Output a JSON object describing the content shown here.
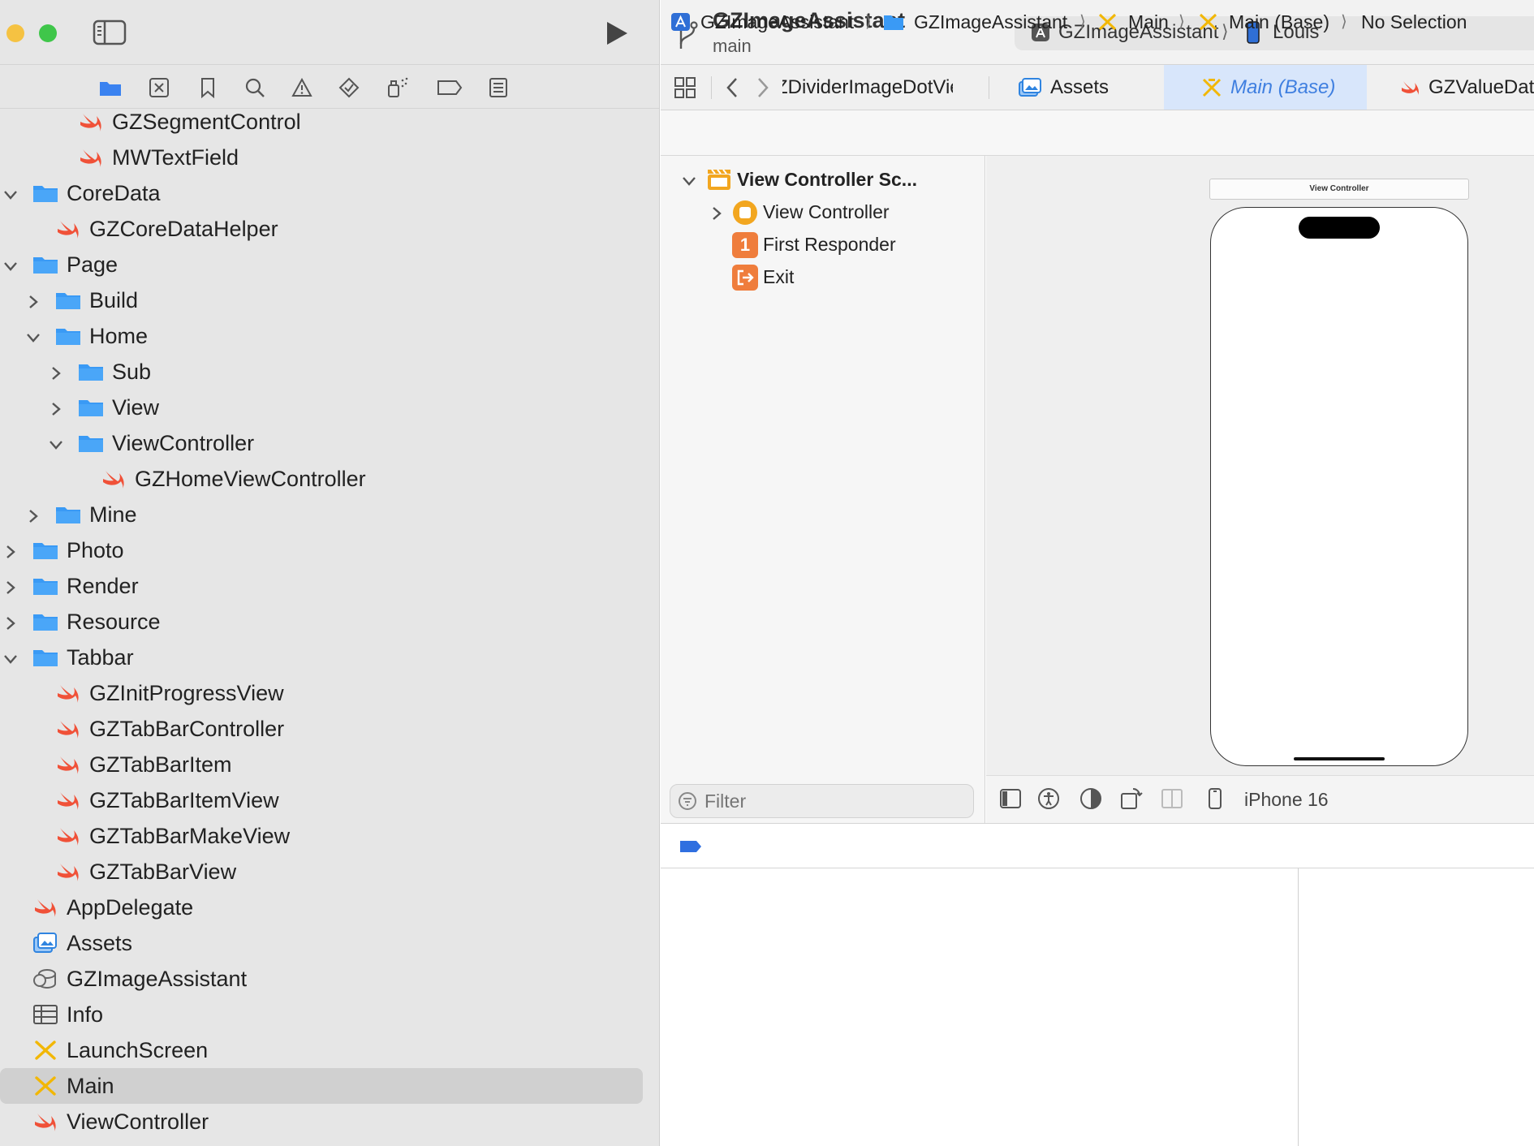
{
  "navigator": {
    "tree": [
      {
        "label": "GZSegmentControl",
        "icon": "swift-file-icon",
        "depth": 3
      },
      {
        "label": "MWTextField",
        "icon": "swift-file-icon",
        "depth": 3
      },
      {
        "label": "CoreData",
        "icon": "folder-icon",
        "depth": 1,
        "disclosure": "expanded"
      },
      {
        "label": "GZCoreDataHelper",
        "icon": "swift-file-icon",
        "depth": 2
      },
      {
        "label": "Page",
        "icon": "folder-icon",
        "depth": 1,
        "disclosure": "expanded"
      },
      {
        "label": "Build",
        "icon": "folder-icon",
        "depth": 2,
        "disclosure": "collapsed"
      },
      {
        "label": "Home",
        "icon": "folder-icon",
        "depth": 2,
        "disclosure": "expanded"
      },
      {
        "label": "Sub",
        "icon": "folder-icon",
        "depth": 3,
        "disclosure": "collapsed"
      },
      {
        "label": "View",
        "icon": "folder-icon",
        "depth": 3,
        "disclosure": "collapsed"
      },
      {
        "label": "ViewController",
        "icon": "folder-icon",
        "depth": 3,
        "disclosure": "expanded"
      },
      {
        "label": "GZHomeViewController",
        "icon": "swift-file-icon",
        "depth": 4
      },
      {
        "label": "Mine",
        "icon": "folder-icon",
        "depth": 2,
        "disclosure": "collapsed"
      },
      {
        "label": "Photo",
        "icon": "folder-icon",
        "depth": 1,
        "disclosure": "collapsed"
      },
      {
        "label": "Render",
        "icon": "folder-icon",
        "depth": 1,
        "disclosure": "collapsed"
      },
      {
        "label": "Resource",
        "icon": "folder-icon",
        "depth": 1,
        "disclosure": "collapsed"
      },
      {
        "label": "Tabbar",
        "icon": "folder-icon",
        "depth": 1,
        "disclosure": "expanded"
      },
      {
        "label": "GZInitProgressView",
        "icon": "swift-file-icon",
        "depth": 2
      },
      {
        "label": "GZTabBarController",
        "icon": "swift-file-icon",
        "depth": 2
      },
      {
        "label": "GZTabBarItem",
        "icon": "swift-file-icon",
        "depth": 2
      },
      {
        "label": "GZTabBarItemView",
        "icon": "swift-file-icon",
        "depth": 2
      },
      {
        "label": "GZTabBarMakeView",
        "icon": "swift-file-icon",
        "depth": 2
      },
      {
        "label": "GZTabBarView",
        "icon": "swift-file-icon",
        "depth": 2
      },
      {
        "label": "AppDelegate",
        "icon": "swift-file-icon",
        "depth": 1
      },
      {
        "label": "Assets",
        "icon": "asset-catalog-icon",
        "depth": 1
      },
      {
        "label": "GZImageAssistant",
        "icon": "coredata-model-icon",
        "depth": 1
      },
      {
        "label": "Info",
        "icon": "plist-icon",
        "depth": 1
      },
      {
        "label": "LaunchScreen",
        "icon": "storyboard-icon",
        "depth": 1
      },
      {
        "label": "Main",
        "icon": "storyboard-icon",
        "depth": 1,
        "selected": true
      },
      {
        "label": "ViewController",
        "icon": "swift-file-icon",
        "depth": 1
      }
    ]
  },
  "toolbar": {
    "project_title": "GZImageAssistant",
    "branch": "main",
    "scheme": "GZImageAssistant",
    "scheme_separator": "⟩",
    "device": "Louis"
  },
  "tabs": [
    {
      "label": "ZDividerImageDotView",
      "icon": "none"
    },
    {
      "label": "Assets",
      "icon": "asset-catalog-icon"
    },
    {
      "label": "Main (Base)",
      "icon": "storyboard-icon",
      "active": true
    },
    {
      "label": "GZValueDat",
      "icon": "swift-file-icon"
    }
  ],
  "jumpbar": {
    "crumbs": [
      "GZImageAssistant",
      "GZImageAssistant",
      "Main",
      "Main (Base)",
      "No Selection"
    ],
    "separator": "⟩"
  },
  "outline": {
    "scene": "View Controller Sc...",
    "view_controller": "View Controller",
    "first_responder": "First Responder",
    "first_responder_badge": "1",
    "exit": "Exit",
    "filter_placeholder": "Filter"
  },
  "canvas": {
    "scene_title": "View Controller",
    "device_label": "iPhone 16"
  },
  "colors": {
    "swift": "#f05138",
    "folder": "#3a9af5",
    "storyboard": "#f2b705",
    "accent": "#3f7fe0",
    "selection": "#d0d0d0"
  }
}
